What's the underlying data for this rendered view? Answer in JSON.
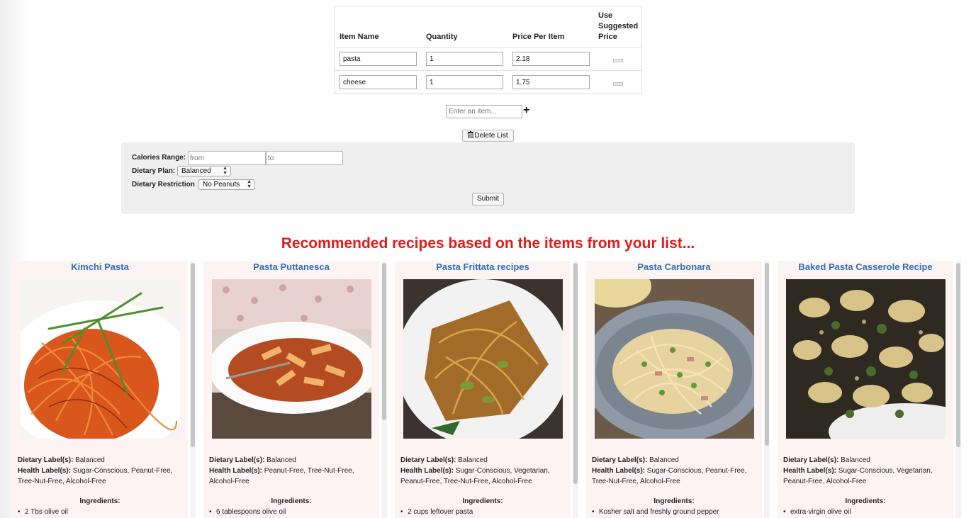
{
  "table": {
    "headers": {
      "item_name": "Item Name",
      "quantity": "Quantity",
      "price": "Price Per Item",
      "suggested_line1": "Use",
      "suggested_line2": "Suggested",
      "suggested_line3": "Price"
    },
    "rows": [
      {
        "name": "pasta",
        "quantity": "1",
        "price": "2.18"
      },
      {
        "name": "cheese",
        "quantity": "1",
        "price": "1.75"
      }
    ]
  },
  "add_item": {
    "placeholder": "Enter an item..."
  },
  "delete_list_label": "Delete List",
  "filters": {
    "calories_label": "Calories Range:",
    "from_placeholder": "from",
    "to_placeholder": "to",
    "diet_plan_label": "Dietary Plan:",
    "diet_plan_value": "Balanced",
    "restriction_label": "Dietary Restriction",
    "restriction_value": "No Peanuts",
    "submit_label": "Submit"
  },
  "recommend_heading": "Recommended recipes based on the items from your list...",
  "labels": {
    "dietary": "Dietary Label(s):",
    "health": "Health Label(s):",
    "ingredients": "Ingredients:"
  },
  "recipes": [
    {
      "title": "Kimchi Pasta",
      "dietary": " Balanced",
      "health": " Sugar-Conscious, Peanut-Free, Tree-Nut-Free, Alcohol-Free",
      "first_ingredient": "2 Tbs olive oil"
    },
    {
      "title": "Pasta Puttanesca",
      "dietary": " Balanced",
      "health": " Peanut-Free, Tree-Nut-Free, Alcohol-Free",
      "first_ingredient": "6 tablespoons olive oil"
    },
    {
      "title": "Pasta Frittata recipes",
      "dietary": " Balanced",
      "health": " Sugar-Conscious, Vegetarian, Peanut-Free, Tree-Nut-Free, Alcohol-Free",
      "first_ingredient": "2 cups leftover pasta"
    },
    {
      "title": "Pasta Carbonara",
      "dietary": " Balanced",
      "health": " Sugar-Conscious, Peanut-Free, Tree-Nut-Free, Alcohol-Free",
      "first_ingredient": "Kosher salt and freshly ground pepper"
    },
    {
      "title": "Baked Pasta Casserole Recipe",
      "dietary": " Balanced",
      "health": " Sugar-Conscious, Vegetarian, Peanut-Free, Alcohol-Free",
      "first_ingredient": "extra-virgin olive oil"
    }
  ],
  "icons": {
    "add": "plus-icon",
    "delete": "trash-icon",
    "select": "select-arrows-icon"
  },
  "colors": {
    "heading": "#e01b1b",
    "recipe_title": "#2f6fb7",
    "card_bg": "#fdf3f3",
    "panel_bg": "#efefef"
  }
}
